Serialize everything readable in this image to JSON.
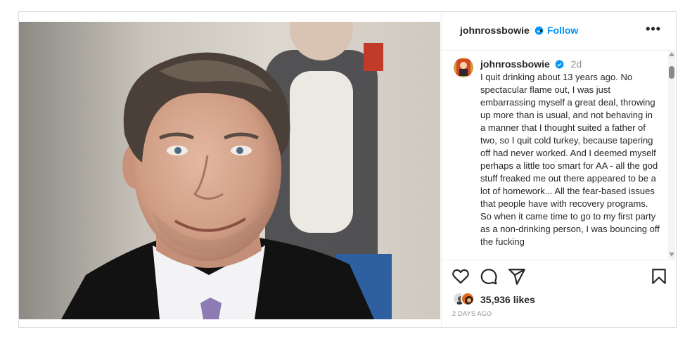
{
  "header": {
    "username": "johnrossbowie",
    "separator": "•",
    "follow_label": "Follow",
    "more_label": "•••"
  },
  "caption": {
    "username": "johnrossbowie",
    "time": "2d",
    "text": "I quit drinking about 13 years ago. No spectacular flame out, I was just embarrassing myself a great deal, throwing up more than is usual, and not behaving in a manner that I thought suited a father of two, so I quit cold turkey, because tapering off had never worked. And I deemed myself perhaps a little too smart for AA - all the god stuff freaked me out there appeared to be a lot of homework... All the fear-based issues that people have with recovery programs. So when it came time to go to my first party as a non-drinking person, I was bouncing off the fucking"
  },
  "actions": {
    "icons": [
      "heart-icon",
      "comment-icon",
      "share-icon",
      "bookmark-icon"
    ]
  },
  "likes": {
    "count_label": "35,936 likes"
  },
  "post_date": "2 DAYS AGO",
  "colors": {
    "accent": "#0095f6",
    "text": "#262626",
    "muted": "#8e8e8e",
    "border": "#dbdbdb"
  }
}
